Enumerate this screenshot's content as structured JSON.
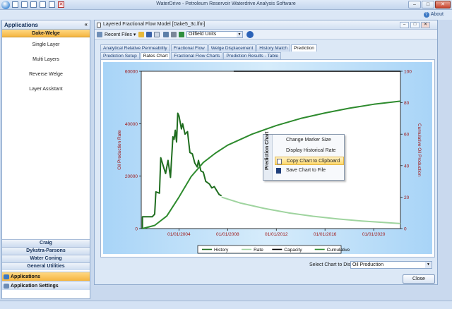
{
  "window": {
    "title": "WaterDrive - Petroleum Reservoir Waterdrive Analysis Software",
    "minimize": "–",
    "maximize": "□",
    "close": "✕"
  },
  "menubar": {
    "about": "About",
    "help_glyph": "?"
  },
  "sidebar": {
    "header": "Applications",
    "collapse": "«",
    "active_section": "Dake-Welge",
    "items": [
      {
        "label": "Single Layer"
      },
      {
        "label": "Multi Layers"
      },
      {
        "label": "Reverse Welge"
      },
      {
        "label": "Layer Assistant"
      }
    ],
    "sections": [
      "Craig",
      "Dykstra-Parsons",
      "Water Coning",
      "General Utilities"
    ],
    "bottom": [
      {
        "label": "Applications",
        "icon": "applications-icon"
      },
      {
        "label": "Application Settings",
        "icon": "settings-icon"
      }
    ]
  },
  "document": {
    "title": "Layered Fractional Flow Model [Dake5_3c.lfm]",
    "recent_files": "Recent Files",
    "units": "Oilfield Units",
    "main_tabs": [
      {
        "label": "Analytical Relative Permeability",
        "active": false
      },
      {
        "label": "Fractional Flow",
        "active": false
      },
      {
        "label": "Welge Displacement",
        "active": false
      },
      {
        "label": "History Match",
        "active": false
      },
      {
        "label": "Prediction",
        "active": true
      }
    ],
    "sub_tabs": [
      {
        "label": "Prediction Setup",
        "active": false
      },
      {
        "label": "Rates Chart",
        "active": true
      },
      {
        "label": "Fractional Flow Charts",
        "active": false
      },
      {
        "label": "Prediction Results - Table",
        "active": false
      }
    ],
    "select_label": "Select Chart to Display",
    "select_value": "Oil Production",
    "close_button": "Close"
  },
  "context_menu": {
    "title": "Prediction Chart",
    "items": [
      {
        "label": "Change Marker Size",
        "highlighted": false,
        "icon": ""
      },
      {
        "label": "Display Historical Rate",
        "highlighted": false,
        "icon": ""
      },
      {
        "label": "Copy Chart to Clipboard",
        "highlighted": true,
        "icon": "copy-icon"
      },
      {
        "label": "Save Chart to File",
        "highlighted": false,
        "icon": "save-icon"
      }
    ]
  },
  "chart_data": {
    "type": "line",
    "ylabel": "Oil Production Rate",
    "y2label": "Cumulative Oil Production",
    "ylim": [
      0,
      60000
    ],
    "y2lim": [
      0,
      100
    ],
    "yticks": [
      0,
      20000,
      40000,
      60000
    ],
    "y2ticks": [
      0,
      20,
      40,
      60,
      80,
      100
    ],
    "xlim": [
      2000.9,
      2022.2
    ],
    "xticks": [
      {
        "x": 2004,
        "label": "01/01/2004"
      },
      {
        "x": 2008,
        "label": "01/01/2008"
      },
      {
        "x": 2012,
        "label": "01/01/2012"
      },
      {
        "x": 2016,
        "label": "01/01/2016"
      },
      {
        "x": 2020,
        "label": "01/01/2020"
      }
    ],
    "legend_position": "bottom",
    "series": [
      {
        "name": "History",
        "axis": "left",
        "color": "#1f6d1f",
        "points": [
          [
            2001.0,
            0
          ],
          [
            2001.0,
            4500
          ],
          [
            2001.6,
            4500
          ],
          [
            2001.8,
            4500
          ],
          [
            2002.0,
            5500
          ],
          [
            2002.1,
            14000
          ],
          [
            2002.4,
            13500
          ],
          [
            2002.5,
            27000
          ],
          [
            2002.7,
            24000
          ],
          [
            2002.9,
            21000
          ],
          [
            2003.1,
            26000
          ],
          [
            2003.3,
            19500
          ],
          [
            2003.5,
            35000
          ],
          [
            2003.6,
            34000
          ],
          [
            2003.7,
            37500
          ],
          [
            2003.8,
            33000
          ],
          [
            2003.9,
            44000
          ],
          [
            2004.0,
            43000
          ],
          [
            2004.2,
            38000
          ],
          [
            2004.3,
            40000
          ],
          [
            2004.5,
            36000
          ],
          [
            2004.7,
            37000
          ],
          [
            2004.9,
            29000
          ],
          [
            2005.1,
            28500
          ],
          [
            2005.3,
            25000
          ],
          [
            2005.5,
            23500
          ],
          [
            2005.6,
            26000
          ],
          [
            2005.8,
            22000
          ],
          [
            2006.0,
            21500
          ],
          [
            2006.2,
            18000
          ],
          [
            2006.5,
            17000
          ],
          [
            2006.7,
            15500
          ],
          [
            2006.9,
            16000
          ],
          [
            2007.1,
            14500
          ],
          [
            2007.3,
            13000
          ],
          [
            2007.5,
            12500
          ]
        ]
      },
      {
        "name": "Rate",
        "axis": "left",
        "color": "#9fd49f",
        "points": [
          [
            2007.5,
            12000
          ],
          [
            2009,
            9800
          ],
          [
            2011,
            7700
          ],
          [
            2013,
            6000
          ],
          [
            2015,
            4700
          ],
          [
            2017,
            3700
          ],
          [
            2019,
            2900
          ],
          [
            2021,
            2300
          ],
          [
            2022.2,
            1900
          ]
        ]
      },
      {
        "name": "Capacity",
        "axis": "left",
        "color": "#000000",
        "points": [
          [
            2008.5,
            60000
          ],
          [
            2022.2,
            60000
          ]
        ]
      },
      {
        "name": "Cumulative",
        "axis": "right",
        "color": "#2e8b2e",
        "points": [
          [
            2001.0,
            0
          ],
          [
            2002,
            2
          ],
          [
            2003,
            8
          ],
          [
            2004,
            20
          ],
          [
            2005,
            33
          ],
          [
            2006,
            42
          ],
          [
            2007,
            48
          ],
          [
            2008,
            53
          ],
          [
            2010,
            60
          ],
          [
            2012,
            65.5
          ],
          [
            2014,
            70
          ],
          [
            2016,
            73.5
          ],
          [
            2018,
            76.5
          ],
          [
            2020,
            79
          ],
          [
            2022.2,
            81
          ]
        ]
      }
    ]
  }
}
